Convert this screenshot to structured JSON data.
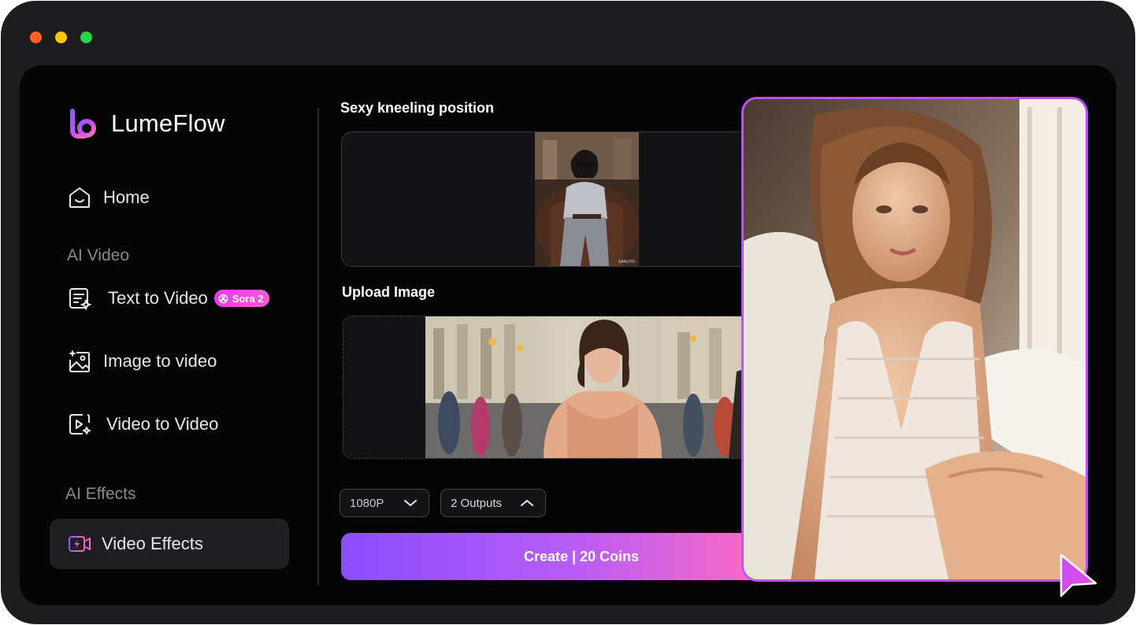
{
  "brand": {
    "name": "LumeFlow"
  },
  "sidebar": {
    "home": "Home",
    "ai_video_label": "AI Video",
    "items": [
      {
        "label": "Text to Video",
        "badge": "Sora 2"
      },
      {
        "label": "Image to video"
      },
      {
        "label": "Video to Video"
      }
    ],
    "ai_effects_label": "AI Effects",
    "active_item": "Video Effects"
  },
  "main": {
    "effect_title": "Sexy kneeling position",
    "upload_title": "Upload Image",
    "resolution": "1080P",
    "outputs": "2 Outputs",
    "create_label": "Create | 20 Coins"
  },
  "colors": {
    "accent_purple": "#c34dff",
    "badge_pink": "#e83cf0",
    "window_bg": "#050505"
  }
}
